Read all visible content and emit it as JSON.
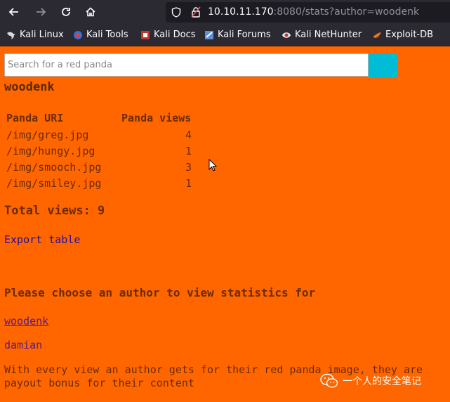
{
  "browser": {
    "url_host": "10.10.11.170",
    "url_rest": ":8080/stats?author=woodenk",
    "bookmarks": [
      {
        "label": "Kali Linux",
        "icon": "kali-dragon-icon"
      },
      {
        "label": "Kali Tools",
        "icon": "kali-tools-icon"
      },
      {
        "label": "Kali Docs",
        "icon": "kali-docs-icon"
      },
      {
        "label": "Kali Forums",
        "icon": "kali-forums-icon"
      },
      {
        "label": "Kali NetHunter",
        "icon": "nethunter-icon"
      },
      {
        "label": "Exploit-DB",
        "icon": "exploit-db-icon"
      }
    ]
  },
  "search": {
    "placeholder": "Search for a red panda"
  },
  "author": "woodenk",
  "table": {
    "headers": [
      "Panda URI",
      "Panda views"
    ],
    "rows": [
      {
        "uri": "/img/greg.jpg",
        "views": "4"
      },
      {
        "uri": "/img/hungy.jpg",
        "views": "1"
      },
      {
        "uri": "/img/smooch.jpg",
        "views": "3"
      },
      {
        "uri": "/img/smiley.jpg",
        "views": "1"
      }
    ]
  },
  "total_views": "Total views: 9",
  "export_label": "Export table",
  "choose_heading": "Please choose an author to view statistics for",
  "authors": [
    "woodenk",
    "damian"
  ],
  "description_line1": "With every view an author gets for their red panda image, they are",
  "description_line2": "payout bonus for their content",
  "watermark_text": "一个人的安全笔记",
  "colors": {
    "page_bg": "#ff6600",
    "search_button": "#00bcd4",
    "browser_chrome": "#2b2a33"
  }
}
